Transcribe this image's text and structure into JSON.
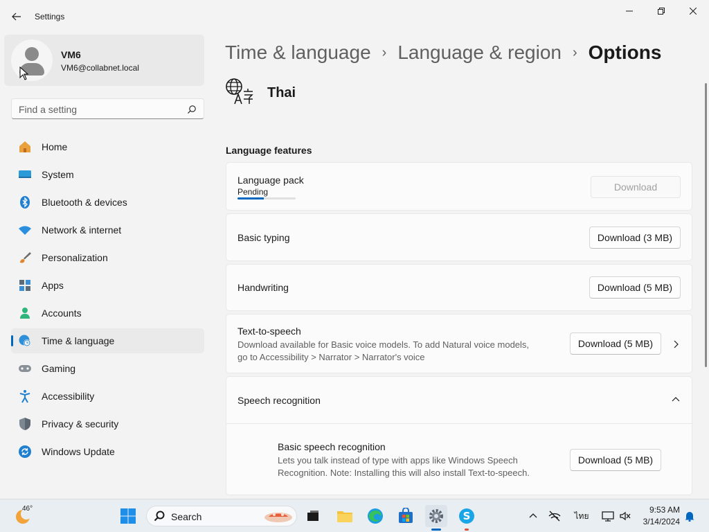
{
  "window": {
    "title": "Settings"
  },
  "profile": {
    "name": "VM6",
    "email": "VM6@collabnet.local"
  },
  "search": {
    "placeholder": "Find a setting"
  },
  "nav": {
    "items": [
      {
        "label": "Home",
        "icon": "home-icon"
      },
      {
        "label": "System",
        "icon": "system-icon"
      },
      {
        "label": "Bluetooth & devices",
        "icon": "bluetooth-icon"
      },
      {
        "label": "Network & internet",
        "icon": "wifi-icon"
      },
      {
        "label": "Personalization",
        "icon": "brush-icon"
      },
      {
        "label": "Apps",
        "icon": "apps-icon"
      },
      {
        "label": "Accounts",
        "icon": "accounts-icon"
      },
      {
        "label": "Time & language",
        "icon": "time-language-icon",
        "active": true
      },
      {
        "label": "Gaming",
        "icon": "gaming-icon"
      },
      {
        "label": "Accessibility",
        "icon": "accessibility-icon"
      },
      {
        "label": "Privacy & security",
        "icon": "shield-icon"
      },
      {
        "label": "Windows Update",
        "icon": "update-icon"
      }
    ]
  },
  "breadcrumb": {
    "part1": "Time & language",
    "part2": "Language & region",
    "current": "Options",
    "separator": "›"
  },
  "language": {
    "name": "Thai"
  },
  "features": {
    "section_title": "Language features",
    "language_pack": {
      "title": "Language pack",
      "status": "Pending",
      "button": "Download",
      "progress": 0.45
    },
    "basic_typing": {
      "title": "Basic typing",
      "button": "Download (3 MB)"
    },
    "handwriting": {
      "title": "Handwriting",
      "button": "Download (5 MB)"
    },
    "tts": {
      "title": "Text-to-speech",
      "desc_line1": "Download available for Basic voice models. To add Natural voice models,",
      "desc_line2": "go to Accessibility > Narrator > Narrator's voice",
      "button": "Download (5 MB)"
    },
    "speech": {
      "title": "Speech recognition"
    },
    "basic_speech": {
      "title": "Basic speech recognition",
      "desc_line1": "Lets you talk instead of type with apps like Windows Speech",
      "desc_line2": "Recognition. Note: Installing this will also install Text-to-speech.",
      "button": "Download (5 MB)"
    }
  },
  "taskbar": {
    "weather_temp": "46°",
    "search_label": "Search",
    "ime_label": "ไทย",
    "time": "9:53 AM",
    "date": "3/14/2024"
  },
  "colors": {
    "accent": "#0067c0"
  }
}
